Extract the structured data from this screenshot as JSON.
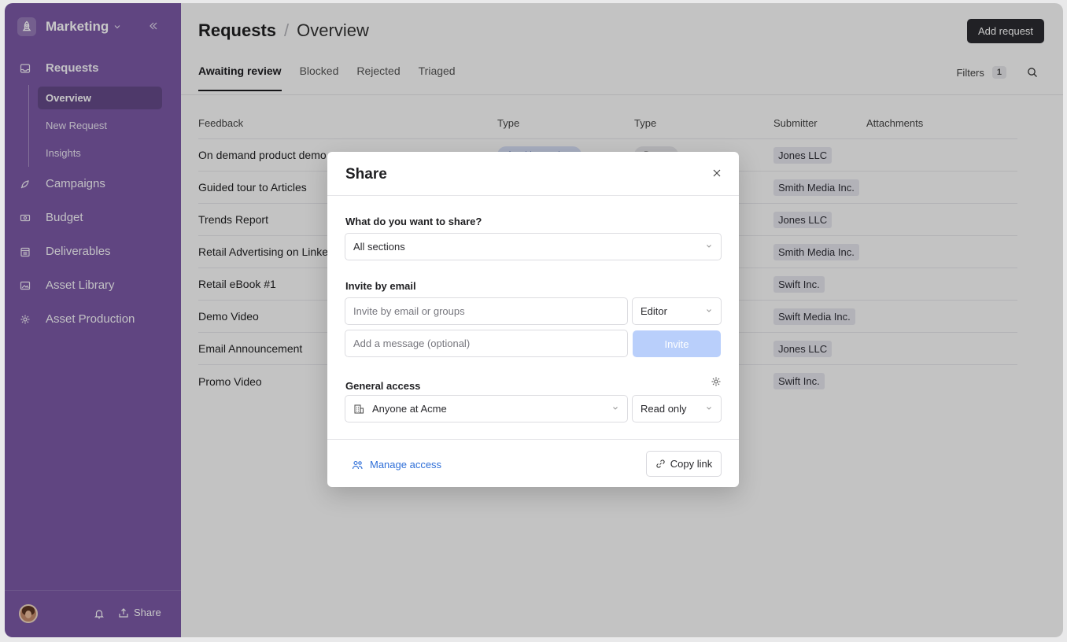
{
  "sidebar": {
    "workspace": "Marketing",
    "nav": [
      {
        "label": "Requests",
        "icon": "inbox-icon"
      },
      {
        "label": "Campaigns",
        "icon": "rocket-icon"
      },
      {
        "label": "Budget",
        "icon": "money-icon"
      },
      {
        "label": "Deliverables",
        "icon": "calendar-icon"
      },
      {
        "label": "Asset Library",
        "icon": "image-icon"
      },
      {
        "label": "Asset Production",
        "icon": "gear-icon"
      }
    ],
    "sub": [
      "Overview",
      "New Request",
      "Insights"
    ],
    "share_label": "Share"
  },
  "header": {
    "title": "Requests",
    "separator": "/",
    "subtitle": "Overview",
    "add_request": "Add request"
  },
  "tabs": [
    "Awaiting review",
    "Blocked",
    "Rejected",
    "Triaged"
  ],
  "filters": {
    "label": "Filters",
    "count": "1"
  },
  "table": {
    "columns": [
      "Feedback",
      "Type",
      "Type",
      "Submitter",
      "Attachments"
    ],
    "rows": [
      {
        "feedback": "On demand product demo",
        "status": "Awaiting review",
        "type": "Demo",
        "submitter": "Jones LLC"
      },
      {
        "feedback": "Guided tour to Articles",
        "submitter": "Smith Media Inc."
      },
      {
        "feedback": "Trends Report",
        "submitter": "Jones LLC"
      },
      {
        "feedback": "Retail Advertising on LinkedIn",
        "submitter": "Smith Media Inc."
      },
      {
        "feedback": "Retail eBook #1",
        "submitter": "Swift Inc."
      },
      {
        "feedback": "Demo Video",
        "submitter": "Swift Media Inc."
      },
      {
        "feedback": "Email Announcement",
        "submitter": "Jones LLC"
      },
      {
        "feedback": "Promo Video",
        "submitter": "Swift Inc."
      }
    ]
  },
  "modal": {
    "title": "Share",
    "what_label": "What do you want to share?",
    "what_value": "All sections",
    "invite_label": "Invite by email",
    "email_placeholder": "Invite by email or groups",
    "role": "Editor",
    "message_placeholder": "Add a message (optional)",
    "invite_button": "Invite",
    "general_label": "General access",
    "access_value": "Anyone at Acme",
    "access_level": "Read only",
    "manage_access": "Manage access",
    "copy_link": "Copy link"
  }
}
